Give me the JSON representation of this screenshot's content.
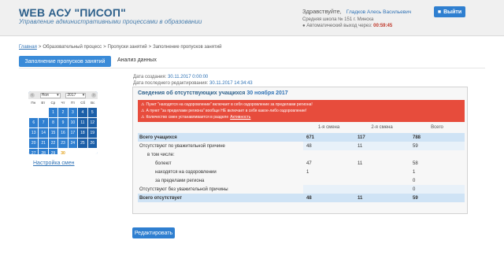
{
  "header": {
    "title": "WEB АСУ \"ПИСОП\"",
    "subtitle": "Управление административными процессами в образовании",
    "greeting": "Здравствуйте,",
    "user": "Гладков Алесь Васильевич",
    "school": "Средняя школа № 151 г. Минска",
    "autoexit_label": "Автоматический выход через:",
    "autoexit_timer": "00:59:45",
    "logout_label": "Выйти"
  },
  "breadcrumb": {
    "home": "Главная",
    "items": [
      "Образовательный процесс",
      "Пропуски занятий",
      "Заполнение пропусков занятий"
    ]
  },
  "tabs": {
    "active": "Заполнение пропусков занятий",
    "other": "Анализ данных"
  },
  "calendar": {
    "month": "Ноя",
    "year": "2017",
    "dow": [
      "Пн",
      "Вт",
      "Ср",
      "Чт",
      "Пт",
      "Сб",
      "Вс"
    ],
    "rows": [
      [
        "",
        "",
        "1",
        "2",
        "3",
        "4",
        "5"
      ],
      [
        "6",
        "7",
        "8",
        "9",
        "10",
        "11",
        "12"
      ],
      [
        "13",
        "14",
        "15",
        "16",
        "17",
        "18",
        "19"
      ],
      [
        "20",
        "21",
        "22",
        "23",
        "24",
        "25",
        "26"
      ],
      [
        "27",
        "28",
        "29",
        "30",
        "",
        "",
        ""
      ]
    ],
    "settings_link": "Настройка смен"
  },
  "dates": {
    "created_label": "Дата создания:",
    "created_value": "30.11.2017 0:00:00",
    "edited_label": "Дата последнего редактирования:",
    "edited_value": "30.11.2017 14:34:43"
  },
  "panel": {
    "title": "Сведения об отсутствующих учащихся",
    "date": "30 ноября 2017",
    "alerts": [
      "Пункт \"находятся на оздоровлении\" включает в себя оздоровление за пределами региона!",
      "А пункт \"за пределами региона\" вообще НЕ включает в себя какое-либо оздоровление!",
      "Количество смен устанавливается в разделе"
    ],
    "alert_link": "Активность",
    "columns": [
      "1-я смена",
      "2-я смена",
      "Всего"
    ],
    "rows": [
      {
        "label": "Всего учащихся",
        "v1": "671",
        "v2": "117",
        "v3": "788"
      },
      {
        "label": "Отсутствуют по уважительной причине",
        "v1": "48",
        "v2": "11",
        "v3": "59"
      },
      {
        "label": "в том числе:",
        "v1": "",
        "v2": "",
        "v3": ""
      },
      {
        "label": "болеют",
        "v1": "47",
        "v2": "11",
        "v3": "58"
      },
      {
        "label": "находятся на оздоровлении",
        "v1": "1",
        "v2": "",
        "v3": "1"
      },
      {
        "label": "за пределами региона",
        "v1": "",
        "v2": "",
        "v3": "0"
      },
      {
        "label": "Отсутствуют без уважительной причины",
        "v1": "",
        "v2": "",
        "v3": "0"
      },
      {
        "label": "Всего отсутствует",
        "v1": "48",
        "v2": "11",
        "v3": "59"
      }
    ]
  },
  "edit_button": "Редактировать",
  "colors": {
    "brand": "#2c5f8a",
    "accent": "#2f7fd0",
    "alert": "#e74c3c",
    "timer": "#c0392b"
  }
}
